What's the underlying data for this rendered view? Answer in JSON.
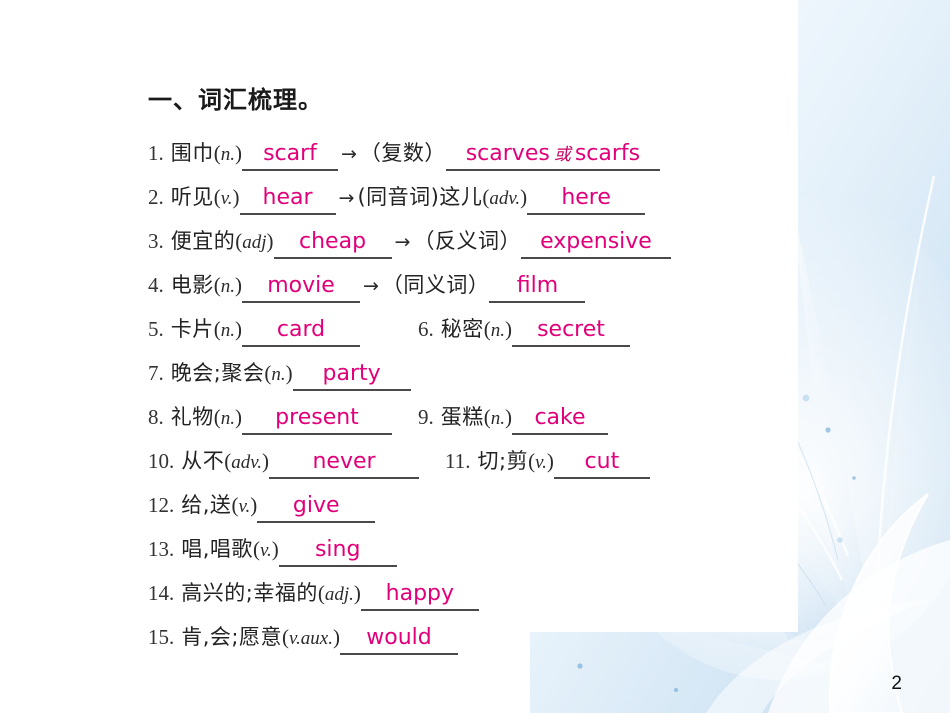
{
  "slide": {
    "page_number": "2",
    "accent_color": "#e2007a",
    "rule_color": "#4a4a4a",
    "background_color": "#ffffff",
    "art_tint": "#bcd8ef"
  },
  "worksheet": {
    "title": "一、词汇梳理。",
    "arrow_glyph": "→",
    "rows": [
      {
        "items": [
          {
            "number": "1.",
            "chinese": "围巾",
            "pos_open": "(",
            "pos": "n.",
            "pos_close": ")",
            "answer": "scarf"
          }
        ],
        "relation": {
          "arrow": "→",
          "label": "（复数）",
          "answer": "scarves",
          "conjunction": "或",
          "answer2": "scarfs"
        }
      },
      {
        "items": [
          {
            "number": "2.",
            "chinese": "听见",
            "pos_open": "(",
            "pos": "v.",
            "pos_close": ")",
            "answer": "hear"
          }
        ],
        "relation": {
          "arrow": "→",
          "label": "(同音词)这儿",
          "pos_open": "(",
          "pos": "adv.",
          "pos_close": ")",
          "answer": "here"
        }
      },
      {
        "items": [
          {
            "number": "3.",
            "chinese": "便宜的",
            "pos_open": "(",
            "pos": "adj",
            "pos_close": ")",
            "answer": "cheap"
          }
        ],
        "relation": {
          "arrow": "→",
          "label": "（反义词）",
          "answer": "expensive"
        }
      },
      {
        "items": [
          {
            "number": "4.",
            "chinese": "电影",
            "pos_open": "(",
            "pos": "n.",
            "pos_close": ")",
            "answer": "movie"
          }
        ],
        "relation": {
          "arrow": "→",
          "label": "（同义词）",
          "answer": "film"
        }
      },
      {
        "items": [
          {
            "number": "5.",
            "chinese": "卡片",
            "pos_open": "(",
            "pos": "n.",
            "pos_close": ")",
            "answer": "card"
          },
          {
            "number": "6.",
            "chinese": "秘密",
            "pos_open": "(",
            "pos": "n.",
            "pos_close": ")",
            "answer": "secret"
          }
        ]
      },
      {
        "items": [
          {
            "number": "7.",
            "chinese": "晚会;聚会",
            "pos_open": "(",
            "pos": "n.",
            "pos_close": ")",
            "answer": "party"
          }
        ]
      },
      {
        "items": [
          {
            "number": "8.",
            "chinese": "礼物",
            "pos_open": "(",
            "pos": "n.",
            "pos_close": ")",
            "answer": "present"
          },
          {
            "number": "9.",
            "chinese": "蛋糕",
            "pos_open": "(",
            "pos": "n.",
            "pos_close": ")",
            "answer": "cake"
          }
        ]
      },
      {
        "items": [
          {
            "number": "10.",
            "chinese": "从不",
            "pos_open": "(",
            "pos": "adv.",
            "pos_close": ")",
            "answer": "never"
          },
          {
            "number": "11.",
            "chinese": "切;剪",
            "pos_open": "(",
            "pos": "v.",
            "pos_close": ")",
            "answer": "cut"
          }
        ]
      },
      {
        "items": [
          {
            "number": "12.",
            "chinese": "给,送",
            "pos_open": "(",
            "pos": "v.",
            "pos_close": ")",
            "answer": "give"
          }
        ]
      },
      {
        "items": [
          {
            "number": "13.",
            "chinese": "唱,唱歌",
            "pos_open": "(",
            "pos": "v.",
            "pos_close": ")",
            "answer": "sing"
          }
        ]
      },
      {
        "items": [
          {
            "number": "14.",
            "chinese": "高兴的;幸福的",
            "pos_open": "(",
            "pos": "adj.",
            "pos_close": ")",
            "answer": "happy"
          }
        ]
      },
      {
        "items": [
          {
            "number": "15.",
            "chinese": "肯,会;愿意",
            "pos_open": "(",
            "pos": "v.aux.",
            "pos_close": ")",
            "answer": "would"
          }
        ]
      }
    ]
  }
}
